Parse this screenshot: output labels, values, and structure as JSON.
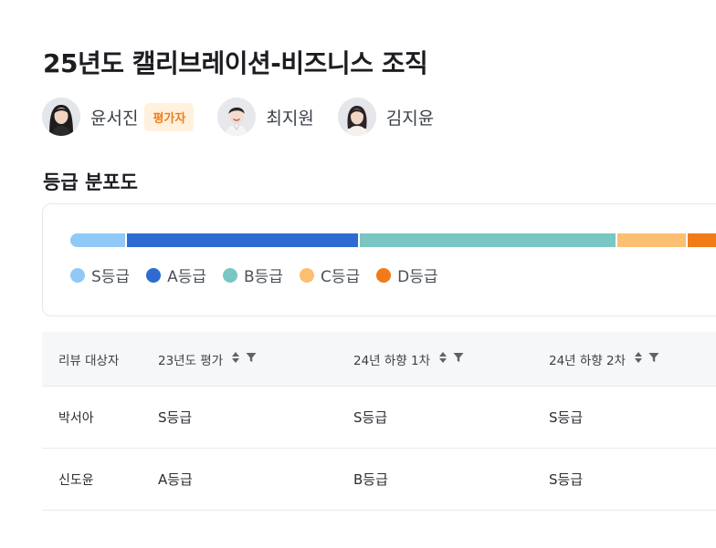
{
  "page": {
    "title": "25년도 캘리브레이션-비즈니스 조직"
  },
  "members": [
    {
      "name": "윤서진",
      "badge": "평가자",
      "avatar_icon": "avatar-woman-long-hair"
    },
    {
      "name": "최지원",
      "badge": "",
      "avatar_icon": "avatar-man-smiling"
    },
    {
      "name": "김지윤",
      "badge": "",
      "avatar_icon": "avatar-woman-short-hair"
    }
  ],
  "distribution": {
    "title": "등급 분포도",
    "grades": [
      {
        "label": "S등급",
        "color": "#90c8f7",
        "share": 0.085
      },
      {
        "label": "A등급",
        "color": "#2e6bd1",
        "share": 0.355
      },
      {
        "label": "B등급",
        "color": "#79c6c3",
        "share": 0.395
      },
      {
        "label": "C등급",
        "color": "#fbbf72",
        "share": 0.105
      },
      {
        "label": "D등급",
        "color": "#f07b17",
        "share": 0.06
      }
    ]
  },
  "table": {
    "headers": [
      "리뷰 대상자",
      "23년도 평가",
      "24년 하향 1차",
      "24년 하향 2차"
    ],
    "rows": [
      [
        "박서아",
        "S등급",
        "S등급",
        "S등급"
      ],
      [
        "신도윤",
        "A등급",
        "B등급",
        "S등급"
      ]
    ]
  }
}
